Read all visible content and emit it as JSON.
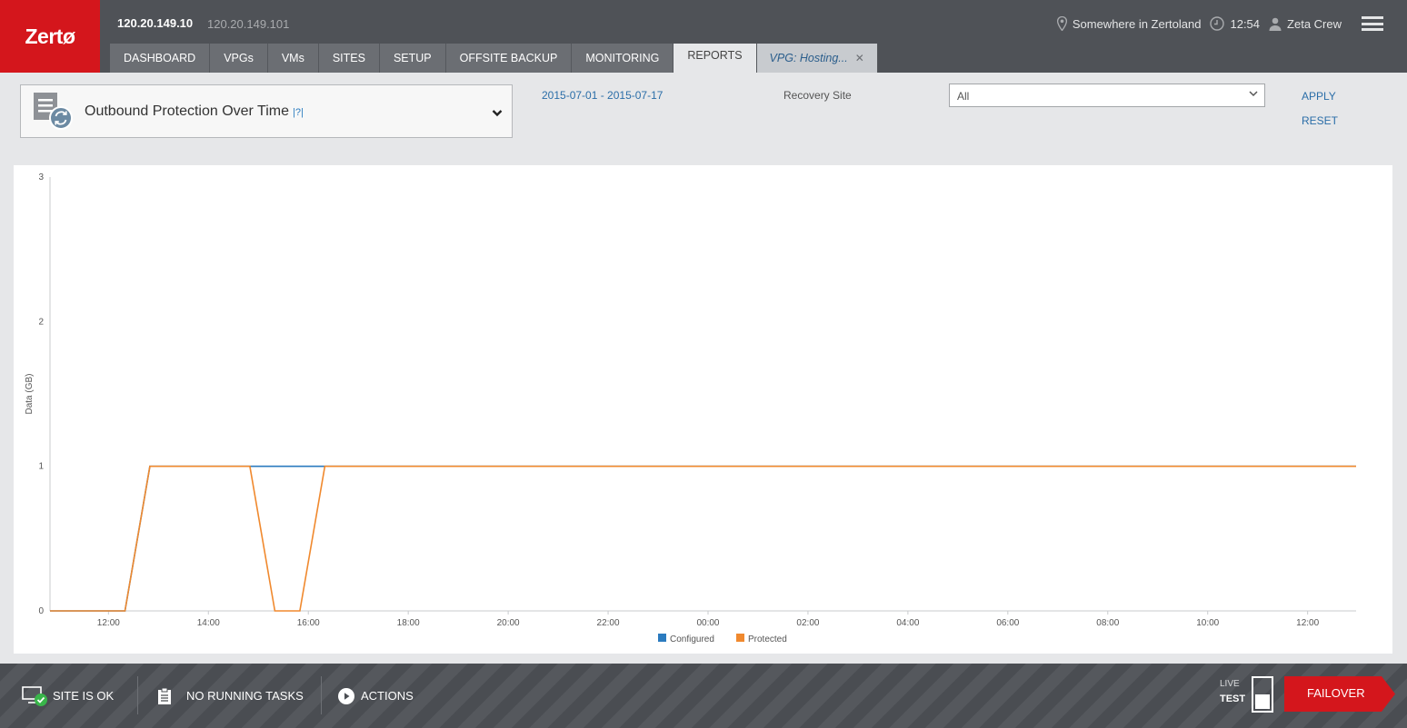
{
  "app": {
    "logo_text": "Zertø",
    "ip_primary": "120.20.149.10",
    "ip_secondary": "120.20.149.101",
    "location": "Somewhere in Zertoland",
    "time": "12:54",
    "user": "Zeta Crew",
    "accent_color": "#d4161c"
  },
  "tabs": [
    {
      "label": "DASHBOARD"
    },
    {
      "label": "VPGs"
    },
    {
      "label": "VMs"
    },
    {
      "label": "SITES"
    },
    {
      "label": "SETUP"
    },
    {
      "label": "OFFSITE BACKUP"
    },
    {
      "label": "MONITORING"
    },
    {
      "label": "REPORTS",
      "active": true
    },
    {
      "label": "VPG: Hosting..."
    }
  ],
  "controls": {
    "report_title": "Outbound Protection Over Time",
    "help_label": "|?|",
    "date_range": "2015-07-01 - 2015-07-17",
    "recovery_site_label": "Recovery Site",
    "recovery_site_value": "All",
    "apply_label": "APPLY",
    "reset_label": "RESET"
  },
  "chart_data": {
    "type": "line",
    "ylabel": "Data (GB)",
    "ylim": [
      0,
      3
    ],
    "yticks": [
      "0",
      "1",
      "2",
      "3"
    ],
    "xticks": [
      "12:00",
      "14:00",
      "16:00",
      "18:00",
      "20:00",
      "22:00",
      "00:00",
      "02:00",
      "04:00",
      "06:00",
      "08:00",
      "10:00",
      "12:00"
    ],
    "x_start_hour": 10.83,
    "x_end_hour": 36.97,
    "legend_position": "bottom-center",
    "series": [
      {
        "name": "Configured",
        "color": "#2b7bbf",
        "points": [
          [
            10.83,
            0
          ],
          [
            12.33,
            0
          ],
          [
            12.83,
            1
          ],
          [
            16.33,
            1
          ],
          [
            16.83,
            1
          ],
          [
            36.97,
            1
          ]
        ]
      },
      {
        "name": "Protected",
        "color": "#f0892e",
        "points": [
          [
            10.83,
            0
          ],
          [
            12.33,
            0
          ],
          [
            12.83,
            1
          ],
          [
            14.83,
            1
          ],
          [
            15.33,
            0
          ],
          [
            15.83,
            0
          ],
          [
            16.33,
            1
          ],
          [
            36.97,
            1
          ]
        ]
      }
    ]
  },
  "footer": {
    "site_status": "SITE IS OK",
    "tasks": "NO RUNNING TASKS",
    "actions": "ACTIONS",
    "live_label": "LIVE",
    "test_label": "TEST",
    "failover_label": "FAILOVER",
    "status_color": "#39b54a"
  }
}
